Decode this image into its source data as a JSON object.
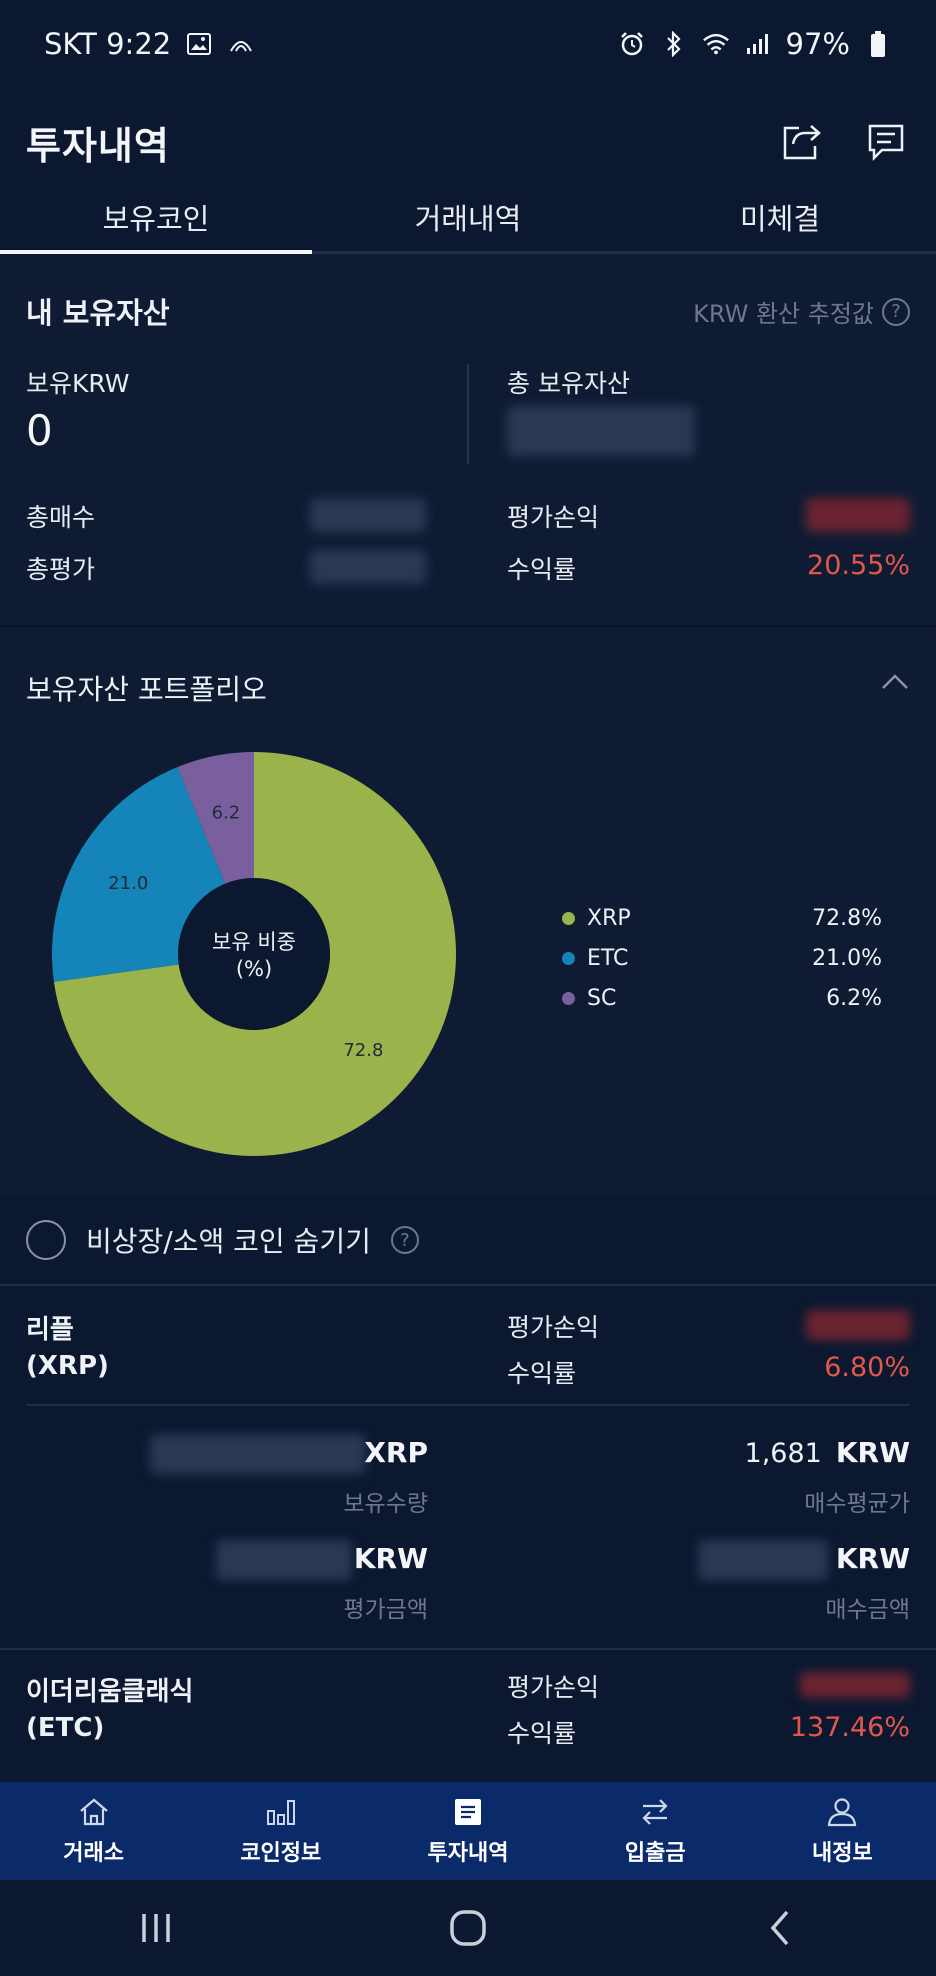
{
  "status_bar": {
    "carrier_time": "SKT 9:22",
    "battery": "97%"
  },
  "header": {
    "title": "투자내역"
  },
  "tabs": [
    {
      "label": "보유코인",
      "active": true
    },
    {
      "label": "거래내역",
      "active": false
    },
    {
      "label": "미체결",
      "active": false
    }
  ],
  "assets": {
    "title": "내 보유자산",
    "krw_note": "KRW 환산 추정값",
    "held_krw_label": "보유KRW",
    "held_krw_value": "0",
    "total_assets_label": "총 보유자산",
    "total_buy_label": "총매수",
    "total_eval_label": "총평가",
    "eval_pl_label": "평가손익",
    "return_label": "수익률",
    "return_value": "20.55%"
  },
  "portfolio": {
    "title": "보유자산 포트폴리오",
    "center_label_line1": "보유 비중",
    "center_label_line2": "(%)",
    "legend": [
      {
        "name": "XRP",
        "value": "72.8%",
        "color": "#9ab34a"
      },
      {
        "name": "ETC",
        "value": "21.0%",
        "color": "#1584b8"
      },
      {
        "name": "SC",
        "value": "6.2%",
        "color": "#7a5f9e"
      }
    ]
  },
  "chart_data": {
    "type": "pie",
    "categories": [
      "XRP",
      "ETC",
      "SC"
    ],
    "values": [
      72.8,
      21.0,
      6.2
    ],
    "slice_labels": [
      "72.8",
      "21.0",
      "6.2"
    ],
    "title": "",
    "donut": true,
    "legend_position": "right"
  },
  "hide_toggle": {
    "label": "비상장/소액 코인 숨기기"
  },
  "coins": [
    {
      "name_line1": "리플",
      "name_line2": "(XRP)",
      "eval_pl_label": "평가손익",
      "return_label": "수익률",
      "return_value": "6.80%",
      "qty_unit": "XRP",
      "qty_label": "보유수량",
      "avg_price_value": "1,681",
      "avg_price_unit": "KRW",
      "avg_price_label": "매수평균가",
      "eval_amount_unit": "KRW",
      "eval_amount_label": "평가금액",
      "buy_amount_unit": "KRW",
      "buy_amount_label": "매수금액"
    },
    {
      "name_line1": "이더리움클래식",
      "name_line2": "(ETC)",
      "eval_pl_label": "평가손익",
      "return_label": "수익률",
      "return_value": "137.46%"
    }
  ],
  "bottom_nav": [
    {
      "label": "거래소",
      "icon": "home-icon"
    },
    {
      "label": "코인정보",
      "icon": "bar-chart-icon"
    },
    {
      "label": "투자내역",
      "icon": "document-icon"
    },
    {
      "label": "입출금",
      "icon": "transfer-icon"
    },
    {
      "label": "내정보",
      "icon": "person-icon"
    }
  ]
}
